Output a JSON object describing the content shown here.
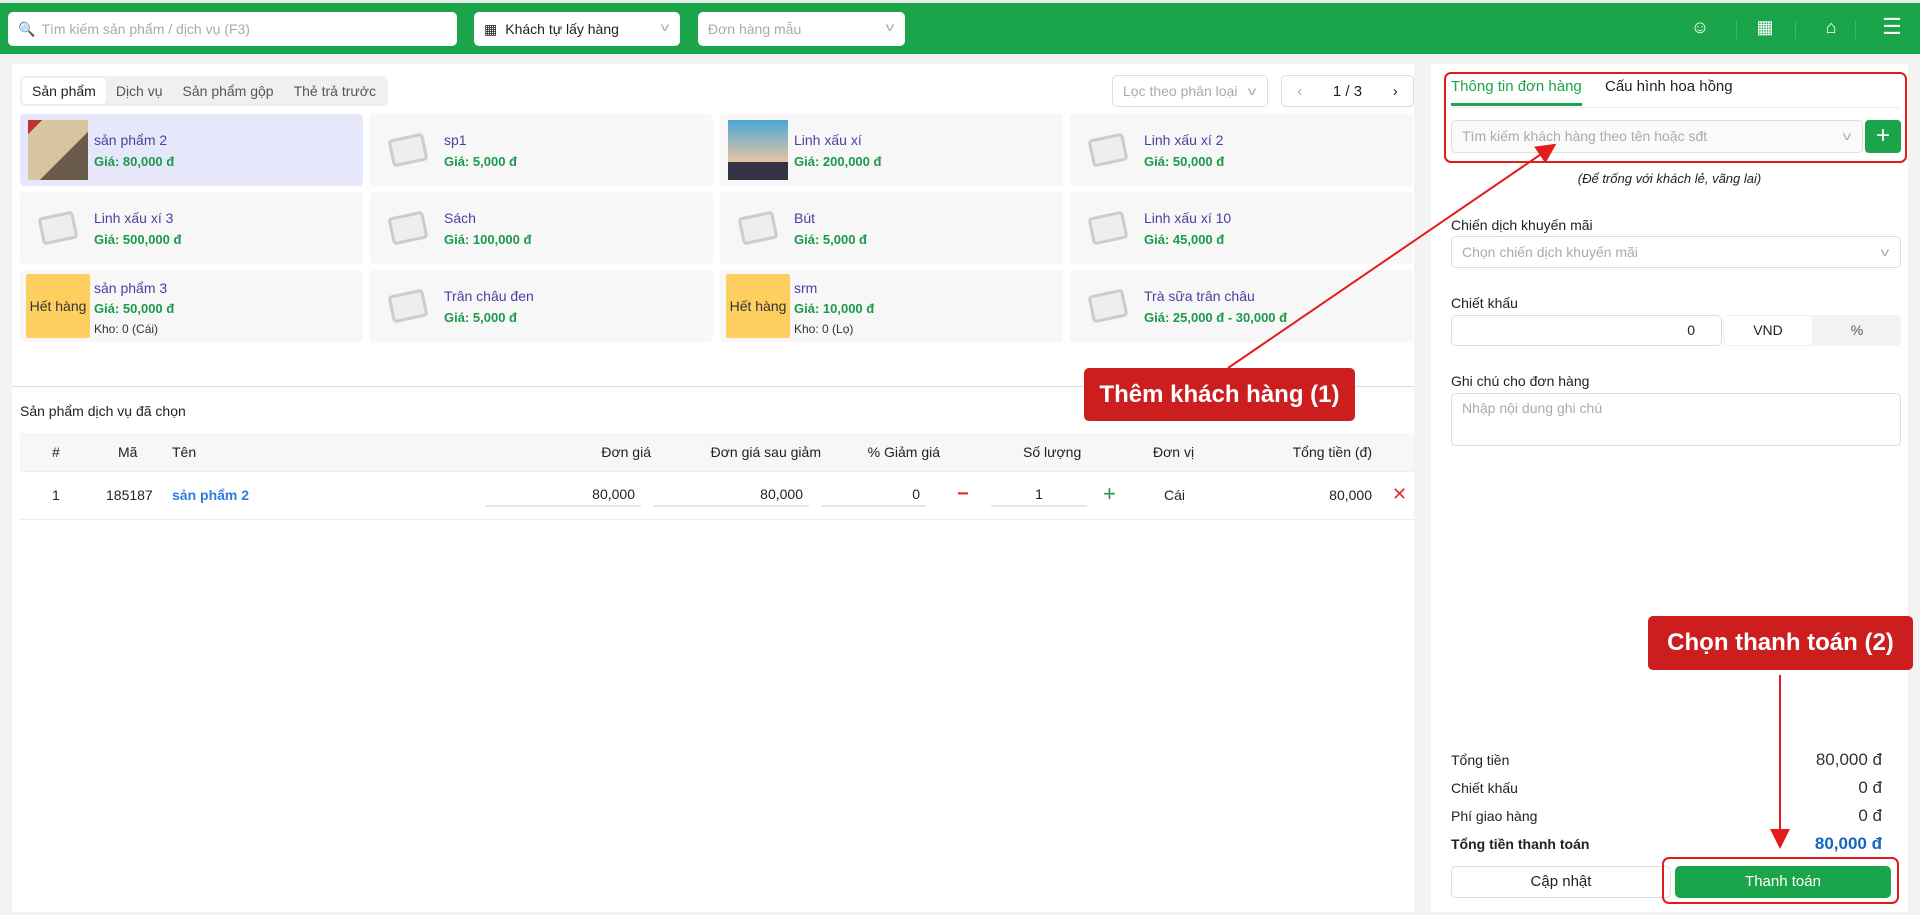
{
  "header": {
    "search_placeholder": "Tìm kiếm sản phẩm / dịch vụ (F3)",
    "delivery_mode": "Khách tự lấy hàng",
    "template_placeholder": "Đơn hàng mẫu"
  },
  "product_tabs": [
    "Sản phẩm",
    "Dịch vụ",
    "Sản phẩm gộp",
    "Thẻ trả trước"
  ],
  "filter_placeholder": "Lọc theo phân loại",
  "pager": {
    "current": "1",
    "sep": "/",
    "total": "3"
  },
  "products": [
    {
      "name": "sản phẩm 2",
      "price": "Giá: 80,000 đ",
      "image": "photo",
      "selected": true
    },
    {
      "name": "sp1",
      "price": "Giá: 5,000 đ",
      "image": "placeholder"
    },
    {
      "name": "Linh xấu xí",
      "price": "Giá: 200,000 đ",
      "image": "city"
    },
    {
      "name": "Linh xấu xí 2",
      "price": "Giá: 50,000 đ",
      "image": "placeholder"
    },
    {
      "name": "Linh xấu xí 3",
      "price": "Giá: 500,000 đ",
      "image": "placeholder"
    },
    {
      "name": "Sách",
      "price": "Giá: 100,000 đ",
      "image": "placeholder"
    },
    {
      "name": "Bút",
      "price": "Giá: 5,000 đ",
      "image": "placeholder"
    },
    {
      "name": "Linh xấu xí 10",
      "price": "Giá: 45,000 đ",
      "image": "placeholder"
    },
    {
      "name": "sản phẩm 3",
      "price": "Giá: 50,000 đ",
      "stock": "Kho: 0 (Cái)",
      "badge": "Hết hàng"
    },
    {
      "name": "Trân châu đen",
      "price": "Giá: 5,000 đ",
      "image": "placeholder"
    },
    {
      "name": "srm",
      "price": "Giá: 10,000 đ",
      "stock": "Kho: 0 (Lọ)",
      "badge": "Hết hàng"
    },
    {
      "name": "Trà sữa trân châu",
      "price": "Giá: 25,000 đ - 30,000 đ",
      "image": "placeholder"
    }
  ],
  "selected_section": {
    "title": "Sản phẩm dịch vụ đã chọn",
    "columns": [
      "#",
      "Mã",
      "Tên",
      "Đơn giá",
      "Đơn giá sau giảm",
      "% Giảm giá",
      "Số lượng",
      "Đơn vị",
      "Tổng tiền (đ)"
    ],
    "rows": [
      {
        "idx": "1",
        "code": "185187",
        "name": "sản phẩm 2",
        "price": "80,000",
        "price_after": "80,000",
        "discount": "0",
        "qty": "1",
        "unit": "Cái",
        "total": "80,000"
      }
    ]
  },
  "order": {
    "tabs": [
      "Thông tin đơn hàng",
      "Cấu hình hoa hồng"
    ],
    "customer_placeholder": "Tìm kiếm khách hàng theo tên hoặc sđt",
    "customer_hint": "(Để trống với khách lẻ, vãng lai)",
    "campaign_label": "Chiến dịch khuyến mãi",
    "campaign_placeholder": "Chọn chiến dịch khuyến mãi",
    "discount_label": "Chiết khấu",
    "discount_value": "0",
    "discount_units": [
      "VND",
      "%"
    ],
    "note_label": "Ghi chú cho đơn hàng",
    "note_placeholder": "Nhập nội dung ghi chú",
    "summary": [
      {
        "label": "Tổng tiền",
        "value": "80,000 đ"
      },
      {
        "label": "Chiết khấu",
        "value": "0 đ"
      },
      {
        "label": "Phí giao hàng",
        "value": "0 đ"
      }
    ],
    "grand_label": "Tổng tiền thanh toán",
    "grand_value": "80,000 đ",
    "update_button": "Cập nhật",
    "pay_button": "Thanh toán"
  },
  "annotations": [
    "Thêm khách hàng (1)",
    "Chọn thanh toán (2)"
  ],
  "colors": {
    "brand": "#1aa54b",
    "annotation": "#cc1e1e",
    "price": "#1a9a4b",
    "name": "#4b3fa0",
    "total": "#1565c0"
  }
}
